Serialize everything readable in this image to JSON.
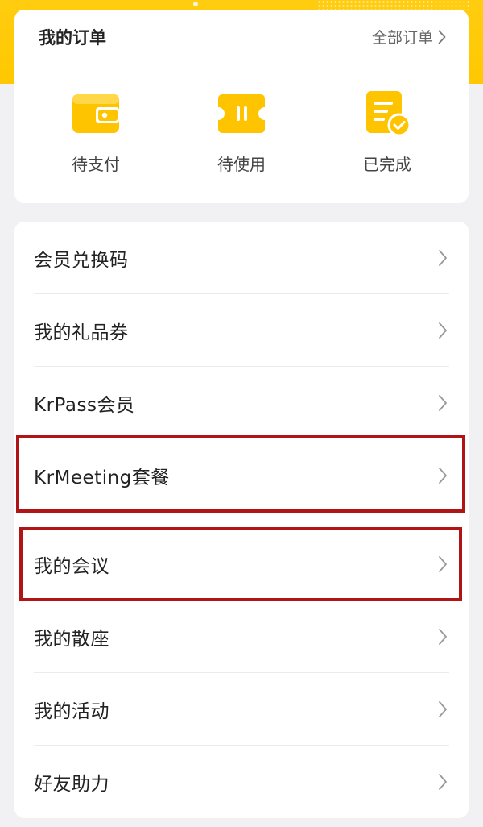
{
  "orders": {
    "title": "我的订单",
    "all_label": "全部订单",
    "items": [
      {
        "label": "待支付",
        "icon": "wallet-icon"
      },
      {
        "label": "待使用",
        "icon": "ticket-icon"
      },
      {
        "label": "已完成",
        "icon": "completed-document-icon"
      }
    ]
  },
  "menu": {
    "items": [
      {
        "label": "会员兑换码"
      },
      {
        "label": "我的礼品券"
      },
      {
        "label": "KrPass会员"
      },
      {
        "label": "KrMeeting套餐"
      },
      {
        "label": "我的会议"
      },
      {
        "label": "我的散座"
      },
      {
        "label": "我的活动"
      },
      {
        "label": "好友助力"
      }
    ]
  },
  "colors": {
    "brand_yellow": "#ffc800",
    "highlight_red": "#b01414"
  }
}
